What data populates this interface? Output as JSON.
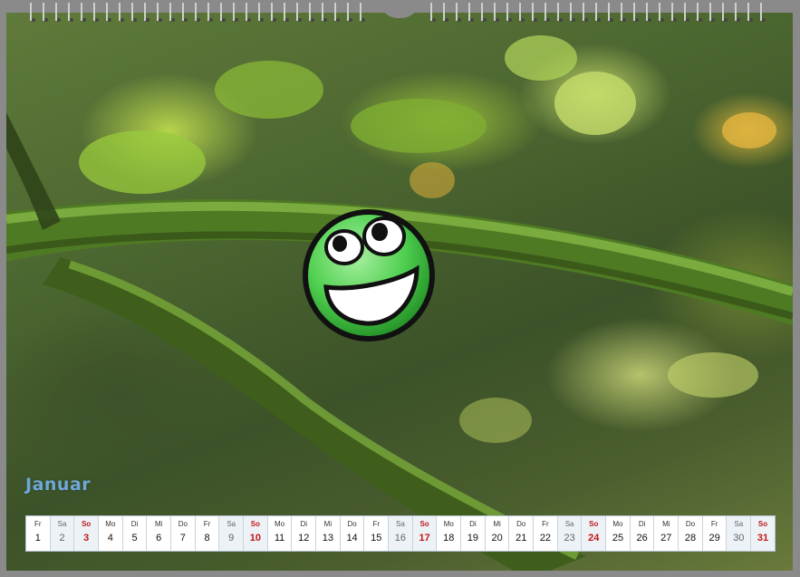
{
  "calendar": {
    "month": "Januar",
    "days": [
      {
        "weekday": "Fr",
        "day": "1",
        "type": "weekday"
      },
      {
        "weekday": "Sa",
        "day": "2",
        "type": "saturday"
      },
      {
        "weekday": "So",
        "day": "3",
        "type": "sunday"
      },
      {
        "weekday": "Mo",
        "day": "4",
        "type": "weekday"
      },
      {
        "weekday": "Di",
        "day": "5",
        "type": "weekday"
      },
      {
        "weekday": "Mi",
        "day": "6",
        "type": "weekday"
      },
      {
        "weekday": "Do",
        "day": "7",
        "type": "weekday"
      },
      {
        "weekday": "Fr",
        "day": "8",
        "type": "weekday"
      },
      {
        "weekday": "Sa",
        "day": "9",
        "type": "saturday"
      },
      {
        "weekday": "So",
        "day": "10",
        "type": "sunday"
      },
      {
        "weekday": "Mo",
        "day": "11",
        "type": "weekday"
      },
      {
        "weekday": "Di",
        "day": "12",
        "type": "weekday"
      },
      {
        "weekday": "Mi",
        "day": "13",
        "type": "weekday"
      },
      {
        "weekday": "Do",
        "day": "14",
        "type": "weekday"
      },
      {
        "weekday": "Fr",
        "day": "15",
        "type": "weekday"
      },
      {
        "weekday": "Sa",
        "day": "16",
        "type": "saturday"
      },
      {
        "weekday": "So",
        "day": "17",
        "type": "sunday"
      },
      {
        "weekday": "Mo",
        "day": "18",
        "type": "weekday"
      },
      {
        "weekday": "Di",
        "day": "19",
        "type": "weekday"
      },
      {
        "weekday": "Mi",
        "day": "20",
        "type": "weekday"
      },
      {
        "weekday": "Do",
        "day": "21",
        "type": "weekday"
      },
      {
        "weekday": "Fr",
        "day": "22",
        "type": "weekday"
      },
      {
        "weekday": "Sa",
        "day": "23",
        "type": "saturday"
      },
      {
        "weekday": "So",
        "day": "24",
        "type": "sunday"
      },
      {
        "weekday": "Mo",
        "day": "25",
        "type": "weekday"
      },
      {
        "weekday": "Di",
        "day": "26",
        "type": "weekday"
      },
      {
        "weekday": "Mi",
        "day": "27",
        "type": "weekday"
      },
      {
        "weekday": "Do",
        "day": "28",
        "type": "weekday"
      },
      {
        "weekday": "Fr",
        "day": "29",
        "type": "weekday"
      },
      {
        "weekday": "Sa",
        "day": "30",
        "type": "saturday"
      },
      {
        "weekday": "So",
        "day": "31",
        "type": "sunday"
      }
    ]
  },
  "icons": {
    "overlay": "grinning-smiley-icon",
    "binding": "spiral-binding-icon"
  },
  "colors": {
    "month_title": "#6fa8d8",
    "sunday": "#c01818",
    "smiley_green": "#4fcf4f"
  }
}
